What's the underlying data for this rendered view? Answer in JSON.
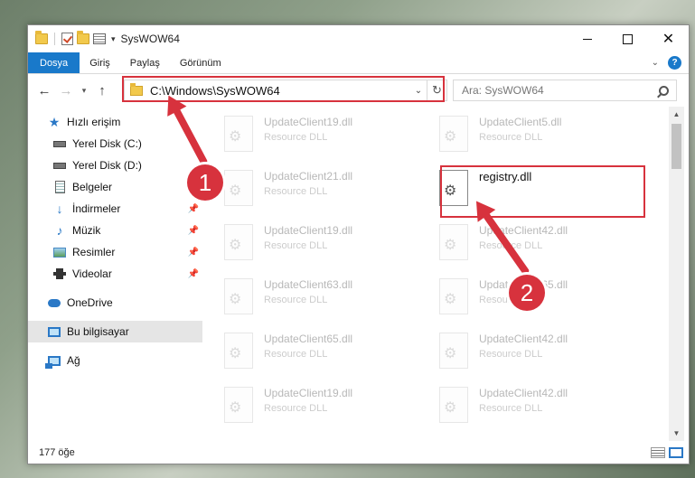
{
  "window": {
    "title": "SysWOW64"
  },
  "ribbon": {
    "tabs": [
      "Dosya",
      "Giriş",
      "Paylaş",
      "Görünüm"
    ],
    "help": "?"
  },
  "address": {
    "path": "C:\\Windows\\SysWOW64"
  },
  "search": {
    "placeholder": "Ara: SysWOW64"
  },
  "sidebar": {
    "items": [
      {
        "label": "Hızlı erişim",
        "icon": "star-icon"
      },
      {
        "label": "Yerel Disk (C:)",
        "icon": "disk-icon"
      },
      {
        "label": "Yerel Disk (D:)",
        "icon": "disk-icon"
      },
      {
        "label": "Belgeler",
        "icon": "documents-icon"
      },
      {
        "label": "İndirmeler",
        "icon": "download-icon"
      },
      {
        "label": "Müzik",
        "icon": "music-icon"
      },
      {
        "label": "Resimler",
        "icon": "pictures-icon"
      },
      {
        "label": "Videolar",
        "icon": "video-icon"
      },
      {
        "label": "OneDrive",
        "icon": "onedrive-icon"
      },
      {
        "label": "Bu bilgisayar",
        "icon": "this-pc-icon"
      },
      {
        "label": "Ağ",
        "icon": "network-icon"
      }
    ]
  },
  "files": [
    {
      "name": "UpdateClient19.dll",
      "type": "Resource DLL"
    },
    {
      "name": "UpdateClient5.dll",
      "type": "Resource DLL"
    },
    {
      "name": "UpdateClient21.dll",
      "type": "Resource DLL"
    },
    {
      "name": "registry.dll",
      "type": ""
    },
    {
      "name": "UpdateClient19.dll",
      "type": "Resource DLL"
    },
    {
      "name": "UpdateClient42.dll",
      "type": "Resource DLL"
    },
    {
      "name": "UpdateClient63.dll",
      "type": "Resource DLL"
    },
    {
      "name": "UpdateClient65.dll",
      "type": "Resource DLL"
    },
    {
      "name": "UpdateClient65.dll",
      "type": "Resource DLL"
    },
    {
      "name": "UpdateClient42.dll",
      "type": "Resource DLL"
    },
    {
      "name": "UpdateClient19.dll",
      "type": "Resource DLL"
    },
    {
      "name": "UpdateClient42.dll",
      "type": "Resource DLL"
    }
  ],
  "status": {
    "count": "177 öğe"
  },
  "callouts": {
    "one": "1",
    "two": "2"
  },
  "colors": {
    "accent": "#1979ca",
    "highlight": "#d7323d"
  }
}
